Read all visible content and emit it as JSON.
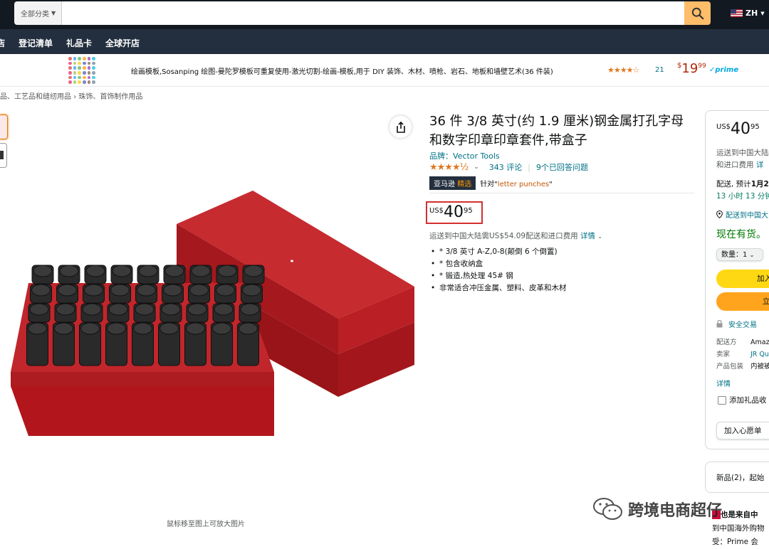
{
  "header": {
    "category_select": "全部分类",
    "search_value": "",
    "language": "ZH"
  },
  "nav": {
    "items": [
      "店",
      "登记清单",
      "礼品卡",
      "全球开店"
    ]
  },
  "sponsored": {
    "text": "绘画模板,Sosanping 绘图-曼陀罗模板可重复使用-激光切割-绘画-模板,用于 DIY 装饰、木材、喷枪、岩石、地板和墙壁艺术(36 件装)",
    "stars": "★★★★☆",
    "rating_count": "21",
    "price_currency": "$",
    "price_whole": "19",
    "price_fraction": "99",
    "prime": "✓prime"
  },
  "breadcrumb": "品、工艺品和缝纫用品 › 珠饰、首饰制作用品",
  "gallery": {
    "zoom_hint": "鼠标移至图上可放大图片"
  },
  "product": {
    "title": "36 件 3/8 英寸(约 1.9 厘米)钢金属打孔字母和数字印章印章套件,带盒子",
    "brand": "品牌：Vector Tools",
    "stars": "★★★★½",
    "reviews": "343 评论",
    "answered": "9个已回答问题",
    "choice_badge_a": "亚马逊",
    "choice_badge_b": "精选",
    "choice_for": "针对\"",
    "choice_keyword": "letter punches",
    "choice_end": "\"",
    "price_currency": "US$",
    "price_whole": "40",
    "price_fraction": "95",
    "shipping": "运送到中国大陆需US$54.09配送和进口费用",
    "shipping_link": "详情",
    "bullets": [
      "* 3/8 英寸 A-Z,0-8(颠倒 6 个倒置)",
      "* 包含收纳盒",
      "* 锻造,热处理 45# 钢",
      "非常适合冲压金属、塑料、皮革和木材"
    ]
  },
  "buybox": {
    "price_currency": "US$",
    "price_whole": "40",
    "price_fraction": "95",
    "ship_line1": "运送到中国大陆",
    "ship_line2": "和进口费用",
    "ship_link": "详",
    "delivery_label": "配送, 预计",
    "delivery_date": "1月2",
    "delivery_countdown": "13 小时 13 分钟",
    "location": "配送到中国大",
    "in_stock": "现在有货。",
    "qty": "数量：1",
    "add_to_cart": "加入",
    "buy_now": "立",
    "secure": "安全交易",
    "info": [
      {
        "k": "配送方",
        "v": "Amaz"
      },
      {
        "k": "卖家",
        "v": "JR Qu"
      },
      {
        "k": "产品包装",
        "v": "内被被"
      }
    ],
    "details": "详情",
    "gift": "添加礼品收",
    "wishlist": "加入心愿单",
    "new_offers": "新品(2)，起始",
    "bottom_line1": "也是来自中",
    "bottom_line2": "到中国海外购物",
    "bottom_line3": "受：Prime 会"
  },
  "watermark": "跨境电商超仔",
  "colors": {
    "header_bg": "#131921",
    "nav_bg": "#232f3e",
    "search_button": "#febd69",
    "price_red": "#b12704",
    "link": "#007185",
    "in_stock": "#007600",
    "add_to_cart": "#ffd814",
    "buy_now": "#ffa41c",
    "highlight_box": "#d32f2f"
  }
}
